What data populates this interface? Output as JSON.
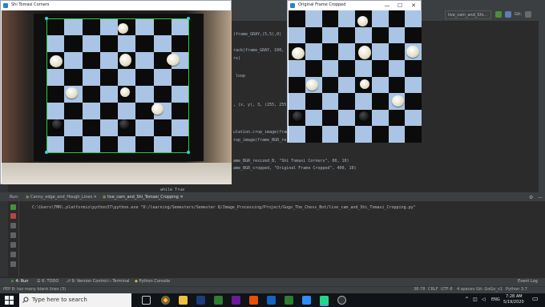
{
  "windows": {
    "shi_window": {
      "title": "Shi Tomasi Corners"
    },
    "crop_window": {
      "title": "Original Frame Cropped"
    },
    "controls": {
      "minimize": "—",
      "maximize": "☐",
      "close": "✕"
    }
  },
  "editor": {
    "lines": [
      {
        "text": "(frame_GRAY,(5,5),0)"
      },
      {
        "text": "rack(frame_GRAY, 100,"
      },
      {
        "text": "rs)"
      },
      {
        "text": "loop"
      },
      {
        "text": ", (x, y), 3, (255, 255"
      },
      {
        "text": "ulation.crop_image(frame_SH"
      },
      {
        "text": "rop_image(frame_BGR_re"
      },
      {
        "text": "ame_BGR_resized_B, \"Shi Tomasi Corners\", 00, 10)"
      },
      {
        "text": "ame_BGR_cropped, \"Original Frame Cropped\", 400, 10)"
      }
    ],
    "bottom_hint_left": "while True",
    "bottom_hint_mid": "while True"
  },
  "toolbar": {
    "run_config": "live_cam_and_Shi...",
    "git_label": "Git:"
  },
  "run_panel": {
    "run_label": "Run:",
    "tabs": [
      "Canny_edge_and_Hough_Lines",
      "live_cam_and_Shi_Tomasi_Cropping"
    ],
    "output": "C:\\Users\\TMR\\.platformio\\python37\\python.exe \"D:/learning/Semesters/Semester 8/Image_Processing/Project/Gogo_The_Chess_Bot/live_cam_and_Shi_Tomasi_Cropping.py\""
  },
  "tool_tabs": [
    "4: Run",
    "6: TODO",
    "9: Version Control",
    "Terminal",
    "Python Console"
  ],
  "event_log": "Event Log",
  "status": {
    "left": "PEP 8: too many blank lines (3)",
    "position": "38:78",
    "line_sep": "CRLF",
    "encoding": "UTF-8",
    "indent": "4 spaces",
    "git": "Git: GoGo_v1",
    "python": "Python 3.7"
  },
  "taskbar": {
    "search_placeholder": "Type here to search",
    "language": "ENG",
    "time": "7:28 AM",
    "date": "5/19/2020"
  },
  "colors": {
    "board_light": "#a9c4e4",
    "board_dark": "#0b0b0b",
    "corner_marker": "#34d2e0",
    "contour": "#2ecc40"
  }
}
